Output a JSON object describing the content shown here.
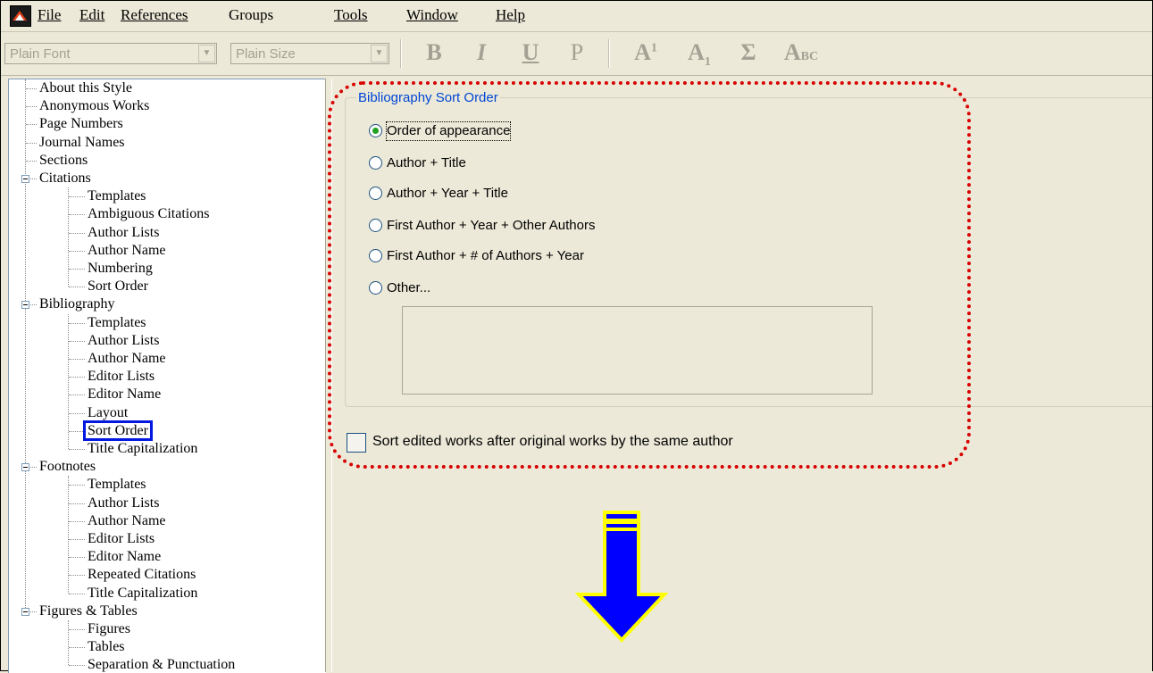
{
  "menubar": {
    "items": [
      {
        "label": "File"
      },
      {
        "label": "Edit"
      },
      {
        "label": "References"
      },
      {
        "label": "Groups"
      },
      {
        "label": "Tools"
      },
      {
        "label": "Window"
      },
      {
        "label": "Help"
      }
    ]
  },
  "toolbar": {
    "font_combo": "Plain Font",
    "size_combo": "Plain Size",
    "bold": "B",
    "italic": "I",
    "underline": "U",
    "plain": "P",
    "superscript_base": "A",
    "superscript_mark": "1",
    "subscript_base": "A",
    "subscript_mark": "1",
    "symbol": "Σ",
    "smallcaps_big": "A",
    "smallcaps_small": "BC"
  },
  "tree": {
    "items": [
      {
        "label": "About this Style"
      },
      {
        "label": "Anonymous Works"
      },
      {
        "label": "Page Numbers"
      },
      {
        "label": "Journal Names"
      },
      {
        "label": "Sections"
      },
      {
        "label": "Citations"
      },
      {
        "label": "Templates"
      },
      {
        "label": "Ambiguous Citations"
      },
      {
        "label": "Author Lists"
      },
      {
        "label": "Author Name"
      },
      {
        "label": "Numbering"
      },
      {
        "label": "Sort Order"
      },
      {
        "label": "Bibliography"
      },
      {
        "label": "Templates"
      },
      {
        "label": "Author Lists"
      },
      {
        "label": "Author Name"
      },
      {
        "label": "Editor Lists"
      },
      {
        "label": "Editor Name"
      },
      {
        "label": "Layout"
      },
      {
        "label": "Sort Order"
      },
      {
        "label": "Title Capitalization"
      },
      {
        "label": "Footnotes"
      },
      {
        "label": "Templates"
      },
      {
        "label": "Author Lists"
      },
      {
        "label": "Author Name"
      },
      {
        "label": "Editor Lists"
      },
      {
        "label": "Editor Name"
      },
      {
        "label": "Repeated Citations"
      },
      {
        "label": "Title Capitalization"
      },
      {
        "label": "Figures & Tables"
      },
      {
        "label": "Figures"
      },
      {
        "label": "Tables"
      },
      {
        "label": "Separation & Punctuation"
      }
    ],
    "selected": "Sort Order"
  },
  "group": {
    "title": "Bibliography Sort Order",
    "options": [
      {
        "label": "Order of appearance",
        "checked": true
      },
      {
        "label": "Author + Title",
        "checked": false
      },
      {
        "label": "Author + Year + Title",
        "checked": false
      },
      {
        "label": "First Author + Year + Other Authors",
        "checked": false
      },
      {
        "label": "First Author + # of Authors + Year",
        "checked": false
      },
      {
        "label": "Other...",
        "checked": false
      }
    ],
    "other_value": ""
  },
  "checkbox": {
    "label": "Sort edited works after original works by the same author",
    "checked": false
  },
  "colors": {
    "highlight": "#d80000",
    "arrow_fill": "#0000ff",
    "arrow_outline": "#ffff00",
    "selection_box": "#0018e0"
  }
}
